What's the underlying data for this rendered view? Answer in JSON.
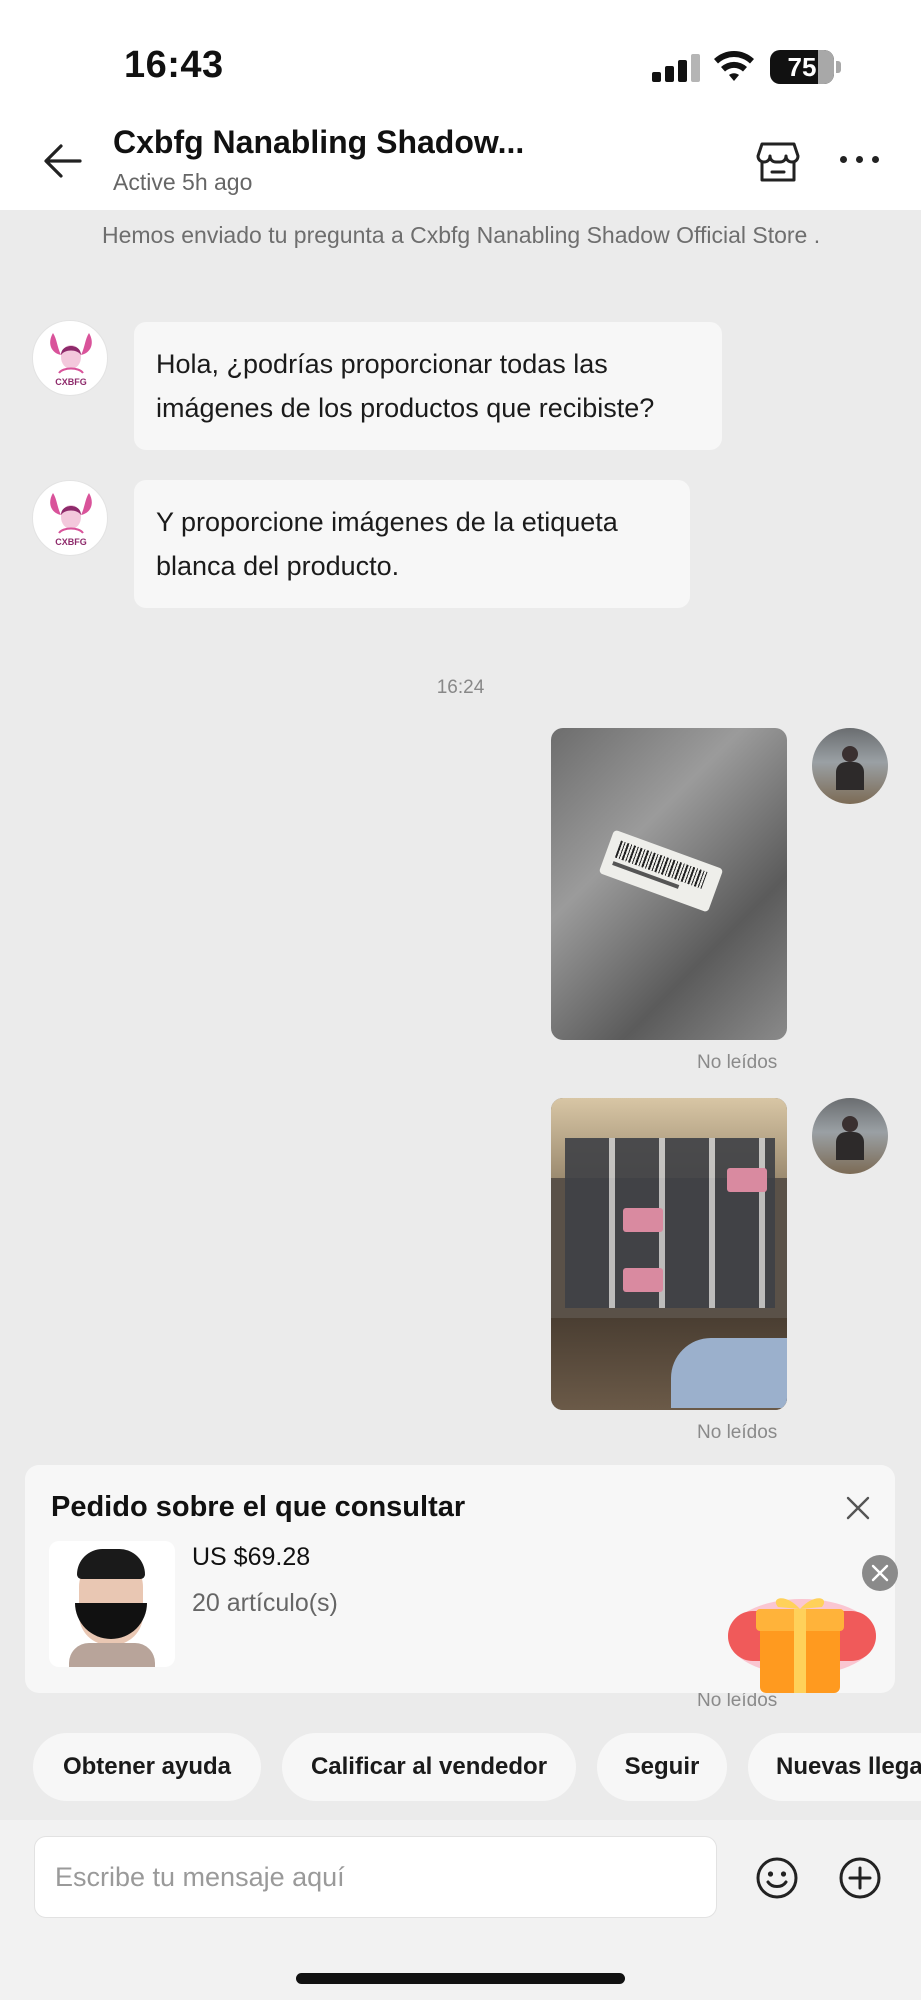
{
  "status_bar": {
    "time": "16:43",
    "battery": "75"
  },
  "header": {
    "back_icon": "arrow-left-icon",
    "store_name": "Cxbfg Nanabling Shadow...",
    "active_status": "Active 5h ago",
    "store_icon": "storefront-icon",
    "more_icon": "more-horizontal-icon"
  },
  "chat": {
    "system_note": "Hemos enviado tu pregunta a Cxbfg Nanabling Shadow Official Store .",
    "store_avatar_text": "CXBFG",
    "messages": [
      {
        "sender": "store",
        "text": "Hola, ¿podrías proporcionar todas las imágenes de los productos que recibiste?"
      },
      {
        "sender": "store",
        "text": "Y proporcione imágenes de la etiqueta blanca del producto."
      }
    ],
    "timestamp": "16:24",
    "sent_photos": [
      {
        "status": "No leídos",
        "description": "barcode-label-package-photo"
      },
      {
        "status": "No leídos",
        "description": "packaged-products-grid-photo"
      }
    ],
    "third_status": "No leídos"
  },
  "order_card": {
    "title": "Pedido sobre el que consultar",
    "price": "US $69.28",
    "quantity": "20 artículo(s)",
    "close_icon": "close-icon",
    "gift_icon": "gift-box-icon"
  },
  "quick_actions": [
    "Obtener ayuda",
    "Calificar al vendedor",
    "Seguir",
    "Nuevas llega"
  ],
  "input": {
    "placeholder": "Escribe tu mensaje aquí",
    "emoji_icon": "smiley-icon",
    "add_icon": "plus-circle-icon"
  },
  "colors": {
    "chat_background": "#ebebeb",
    "bubble": "#f7f7f7",
    "accent_gift": "#ff7a1a"
  }
}
